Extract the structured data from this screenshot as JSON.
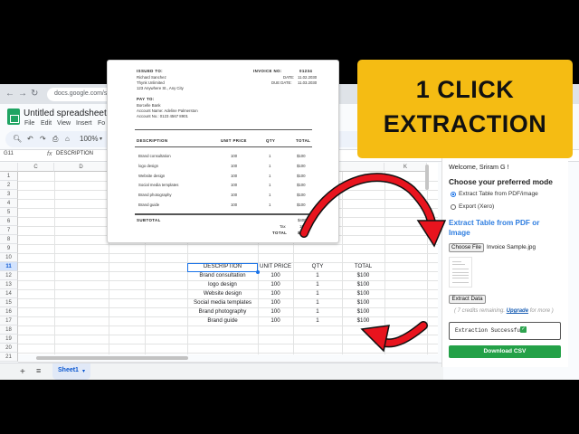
{
  "browser": {
    "url": "docs.google.com/sp"
  },
  "sheets": {
    "title": "Untitled spreadsheet",
    "menus": [
      "File",
      "Edit",
      "View",
      "Insert",
      "Fo"
    ],
    "zoom": "100%",
    "name_box": "G11",
    "fx": "fx",
    "formula_value": "DESCRIPTION",
    "columns": [
      "C",
      "D",
      "K"
    ],
    "rows": [
      "1",
      "2",
      "3",
      "4",
      "5",
      "6",
      "7",
      "8",
      "9",
      "10",
      "11",
      "12",
      "13",
      "14",
      "15",
      "16",
      "17",
      "18",
      "19",
      "20",
      "21"
    ],
    "selected_row": "11",
    "table": {
      "headers": [
        "DESCRIPTION",
        "UNIT PRICE",
        "QTY",
        "TOTAL"
      ],
      "rows": [
        [
          "Brand consultation",
          "100",
          "1",
          "$100"
        ],
        [
          "logo design",
          "100",
          "1",
          "$100"
        ],
        [
          "Website design",
          "100",
          "1",
          "$100"
        ],
        [
          "Social media templates",
          "100",
          "1",
          "$100"
        ],
        [
          "Brand photography",
          "100",
          "1",
          "$100"
        ],
        [
          "Brand guide",
          "100",
          "1",
          "$100"
        ]
      ]
    },
    "sheet_tab": "Sheet1",
    "add_sheet": "+",
    "all_sheets": "≡"
  },
  "invoice": {
    "issued_to_label": "ISSUED TO:",
    "issued_to": [
      "Richard Sanchez",
      "Thynk Unlimited",
      "123 Anywhere St., Any City"
    ],
    "invoice_no_label": "INVOICE NO:",
    "invoice_no": "01234",
    "date_label": "DATE:",
    "date": "11.02.2030",
    "due_label": "DUE DATE:",
    "due": "11.03.2030",
    "pay_to_label": "PAY TO:",
    "pay_to": [
      "Borcelle Bank",
      "Account Name: Adeline Palmerston",
      "Account No.: 0123 4567 8901"
    ],
    "headers": [
      "DESCRIPTION",
      "UNIT PRICE",
      "QTY",
      "TOTAL"
    ],
    "rows": [
      [
        "Brand consultation",
        "100",
        "1",
        "$100"
      ],
      [
        "logo design",
        "100",
        "1",
        "$100"
      ],
      [
        "Website design",
        "100",
        "1",
        "$100"
      ],
      [
        "Social media templates",
        "100",
        "1",
        "$100"
      ],
      [
        "Brand photography",
        "100",
        "1",
        "$100"
      ],
      [
        "Brand guide",
        "100",
        "1",
        "$100"
      ]
    ],
    "subtotal_label": "SUBTOTAL",
    "subtotal": "$400",
    "tax_label": "Tax",
    "tax": "10%",
    "total_label": "TOTAL",
    "total": "$440"
  },
  "panel": {
    "welcome": "Welcome, Sriram G !",
    "mode_title": "Choose your preferred mode",
    "option_pdf": "Extract Table from PDF/image",
    "option_xero": "Export (Xero)",
    "section_title": "Extract Table from PDF or Image",
    "choose_file": "Choose File",
    "file_name": "Invoice Sample.jpg",
    "extract_button": "Extract Data",
    "credits_prefix": "( 7 credits remaining.",
    "credits_link": "Upgrade",
    "credits_suffix": "for more )",
    "status": "Extraction Successful",
    "download_button": "Download CSV"
  },
  "banner": {
    "line1": "1 CLICK",
    "line2": "EXTRACTION"
  },
  "colors": {
    "banner": "#f5bc13",
    "arrow": "#e8141e",
    "download": "#24a148",
    "link": "#2f7ee0"
  },
  "icons": [
    "back-icon",
    "forward-icon",
    "reload-icon",
    "search-icon",
    "undo-icon",
    "redo-icon",
    "print-icon",
    "paint-format-icon",
    "sheets-logo-icon",
    "check-icon"
  ]
}
